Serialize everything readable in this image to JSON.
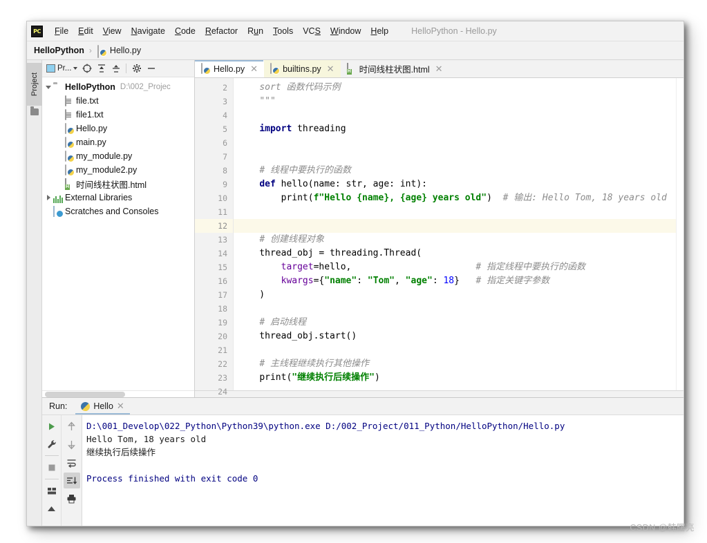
{
  "window": {
    "title": "HelloPython - Hello.py",
    "logo_text": "PC"
  },
  "menubar": {
    "items": [
      {
        "label": "File",
        "mnemonic": "F"
      },
      {
        "label": "Edit",
        "mnemonic": "E"
      },
      {
        "label": "View",
        "mnemonic": "V"
      },
      {
        "label": "Navigate",
        "mnemonic": "N"
      },
      {
        "label": "Code",
        "mnemonic": "C"
      },
      {
        "label": "Refactor",
        "mnemonic": "R"
      },
      {
        "label": "Run",
        "mnemonic": "u"
      },
      {
        "label": "Tools",
        "mnemonic": "T"
      },
      {
        "label": "VCS",
        "mnemonic": "S"
      },
      {
        "label": "Window",
        "mnemonic": "W"
      },
      {
        "label": "Help",
        "mnemonic": "H"
      }
    ]
  },
  "breadcrumb": {
    "project": "HelloPython",
    "separator": "›",
    "file": "Hello.py"
  },
  "toolwindow_strip": {
    "project_tab": "Project"
  },
  "project_panel": {
    "title": "Pr...",
    "tree": [
      {
        "label": "HelloPython",
        "path": "D:\\002_Projec",
        "icon": "folder-icon",
        "indent": 0,
        "expanded": true,
        "bold": true
      },
      {
        "label": "file.txt",
        "path": "",
        "icon": "text-file-icon",
        "indent": 1,
        "expanded": null,
        "bold": false
      },
      {
        "label": "file1.txt",
        "path": "",
        "icon": "text-file-icon",
        "indent": 1,
        "expanded": null,
        "bold": false
      },
      {
        "label": "Hello.py",
        "path": "",
        "icon": "python-file-icon",
        "indent": 1,
        "expanded": null,
        "bold": false
      },
      {
        "label": "main.py",
        "path": "",
        "icon": "python-file-icon",
        "indent": 1,
        "expanded": null,
        "bold": false
      },
      {
        "label": "my_module.py",
        "path": "",
        "icon": "python-file-icon",
        "indent": 1,
        "expanded": null,
        "bold": false
      },
      {
        "label": "my_module2.py",
        "path": "",
        "icon": "python-file-icon",
        "indent": 1,
        "expanded": null,
        "bold": false
      },
      {
        "label": "时间线柱状图.html",
        "path": "",
        "icon": "html-file-icon",
        "indent": 1,
        "expanded": null,
        "bold": false
      },
      {
        "label": "External Libraries",
        "path": "",
        "icon": "library-icon",
        "indent": 0,
        "expanded": false,
        "bold": false
      },
      {
        "label": "Scratches and Consoles",
        "path": "",
        "icon": "scratches-icon",
        "indent": 0,
        "expanded": null,
        "bold": false
      }
    ],
    "toolbar_icons": [
      "target-icon",
      "expand-all-icon",
      "collapse-all-icon",
      "gear-icon",
      "minimize-icon"
    ]
  },
  "editor": {
    "tabs": [
      {
        "label": "Hello.py",
        "icon": "python-file-icon",
        "active": true,
        "highlight": false
      },
      {
        "label": "builtins.py",
        "icon": "python-file-icon",
        "active": false,
        "highlight": true
      },
      {
        "label": "时间线柱状图.html",
        "icon": "html-file-icon",
        "active": false,
        "highlight": false
      }
    ],
    "first_line_number": 2,
    "current_line": 12,
    "lines": [
      {
        "num": 2,
        "fold": "",
        "tokens": [
          {
            "t": "    ",
            "c": "cn"
          },
          {
            "t": "sort 函数代码示例",
            "c": "c"
          }
        ]
      },
      {
        "num": 3,
        "fold": "⊟",
        "tokens": [
          {
            "t": "    ",
            "c": "cn"
          },
          {
            "t": "\"\"\"",
            "c": "c"
          }
        ]
      },
      {
        "num": 4,
        "fold": "",
        "tokens": []
      },
      {
        "num": 5,
        "fold": "",
        "tokens": [
          {
            "t": "    ",
            "c": "cn"
          },
          {
            "t": "import",
            "c": "k"
          },
          {
            "t": " threading",
            "c": "cn"
          }
        ]
      },
      {
        "num": 6,
        "fold": "",
        "tokens": []
      },
      {
        "num": 7,
        "fold": "",
        "tokens": []
      },
      {
        "num": 8,
        "fold": "",
        "tokens": [
          {
            "t": "    ",
            "c": "cn"
          },
          {
            "t": "# 线程中要执行的函数",
            "c": "c"
          }
        ]
      },
      {
        "num": 9,
        "fold": "⊟",
        "tokens": [
          {
            "t": "    ",
            "c": "cn"
          },
          {
            "t": "def",
            "c": "k"
          },
          {
            "t": " hello(name: ",
            "c": "cn"
          },
          {
            "t": "str",
            "c": "cn"
          },
          {
            "t": ", age: ",
            "c": "cn"
          },
          {
            "t": "int",
            "c": "cn"
          },
          {
            "t": "):",
            "c": "cn"
          }
        ]
      },
      {
        "num": 10,
        "fold": "⊟",
        "tokens": [
          {
            "t": "        ",
            "c": "cn"
          },
          {
            "t": "print",
            "c": "cn"
          },
          {
            "t": "(",
            "c": "cn"
          },
          {
            "t": "f\"Hello ",
            "c": "s"
          },
          {
            "t": "{name}",
            "c": "s"
          },
          {
            "t": ", ",
            "c": "s"
          },
          {
            "t": "{age}",
            "c": "s"
          },
          {
            "t": " years old\"",
            "c": "s"
          },
          {
            "t": ")  ",
            "c": "cn"
          },
          {
            "t": "# 输出: Hello Tom, 18 years old",
            "c": "c"
          }
        ]
      },
      {
        "num": 11,
        "fold": "",
        "tokens": []
      },
      {
        "num": 12,
        "fold": "",
        "tokens": []
      },
      {
        "num": 13,
        "fold": "",
        "tokens": [
          {
            "t": "    ",
            "c": "cn"
          },
          {
            "t": "# 创建线程对象",
            "c": "c"
          }
        ]
      },
      {
        "num": 14,
        "fold": "",
        "tokens": [
          {
            "t": "    thread_obj = threading.Thread(",
            "c": "cn"
          }
        ]
      },
      {
        "num": 15,
        "fold": "",
        "tokens": [
          {
            "t": "        ",
            "c": "cn"
          },
          {
            "t": "target",
            "c": "kw"
          },
          {
            "t": "=hello,",
            "c": "cn"
          },
          {
            "t": "                       ",
            "c": "cn"
          },
          {
            "t": "# 指定线程中要执行的函数",
            "c": "c"
          }
        ]
      },
      {
        "num": 16,
        "fold": "",
        "tokens": [
          {
            "t": "        ",
            "c": "cn"
          },
          {
            "t": "kwargs",
            "c": "kw"
          },
          {
            "t": "={",
            "c": "cn"
          },
          {
            "t": "\"name\"",
            "c": "s"
          },
          {
            "t": ": ",
            "c": "cn"
          },
          {
            "t": "\"Tom\"",
            "c": "s"
          },
          {
            "t": ", ",
            "c": "cn"
          },
          {
            "t": "\"age\"",
            "c": "s"
          },
          {
            "t": ": ",
            "c": "cn"
          },
          {
            "t": "18",
            "c": "n"
          },
          {
            "t": "}   ",
            "c": "cn"
          },
          {
            "t": "# 指定关键字参数",
            "c": "c"
          }
        ]
      },
      {
        "num": 17,
        "fold": "",
        "tokens": [
          {
            "t": "    )",
            "c": "cn"
          }
        ]
      },
      {
        "num": 18,
        "fold": "",
        "tokens": []
      },
      {
        "num": 19,
        "fold": "",
        "tokens": [
          {
            "t": "    ",
            "c": "cn"
          },
          {
            "t": "# 启动线程",
            "c": "c"
          }
        ]
      },
      {
        "num": 20,
        "fold": "",
        "tokens": [
          {
            "t": "    thread_obj.start()",
            "c": "cn"
          }
        ]
      },
      {
        "num": 21,
        "fold": "",
        "tokens": []
      },
      {
        "num": 22,
        "fold": "",
        "tokens": [
          {
            "t": "    ",
            "c": "cn"
          },
          {
            "t": "# 主线程继续执行其他操作",
            "c": "c"
          }
        ]
      },
      {
        "num": 23,
        "fold": "",
        "tokens": [
          {
            "t": "    ",
            "c": "cn"
          },
          {
            "t": "print",
            "c": "cn"
          },
          {
            "t": "(",
            "c": "cn"
          },
          {
            "t": "\"继续执行后续操作\"",
            "c": "s"
          },
          {
            "t": ")",
            "c": "cn"
          }
        ]
      },
      {
        "num": 24,
        "fold": "",
        "tokens": []
      }
    ]
  },
  "run_panel": {
    "label": "Run:",
    "tab_label": "Hello",
    "tools_left": [
      "run-icon",
      "wrench-icon",
      "stop-icon",
      "layout-icon",
      "pin-icon"
    ],
    "tools_right": [
      "arrow-up-icon",
      "arrow-down-icon",
      "soft-wrap-icon",
      "scroll-to-end-icon",
      "print-icon"
    ],
    "console": [
      {
        "text": "D:\\001_Develop\\022_Python\\Python39\\python.exe D:/002_Project/011_Python/HelloPython/Hello.py",
        "color": "co-blue"
      },
      {
        "text": "Hello Tom, 18 years old",
        "color": "co-black"
      },
      {
        "text": "继续执行后续操作",
        "color": "co-black"
      },
      {
        "text": "",
        "color": "co-black"
      },
      {
        "text": "Process finished with exit code 0",
        "color": "co-blue"
      }
    ]
  },
  "watermark": {
    "text": "CSDN @韩曙亮"
  },
  "colors": {
    "keyword": "#000080",
    "string": "#008000",
    "number": "#0000ff",
    "comment": "#8c8c8c",
    "kwarg": "#660099",
    "current_line_bg": "#fcf9e9",
    "tab_highlight_bg": "#f7f6dd",
    "tab_underline": "#9ab9d6",
    "panel_bg": "#f2f2f2"
  }
}
